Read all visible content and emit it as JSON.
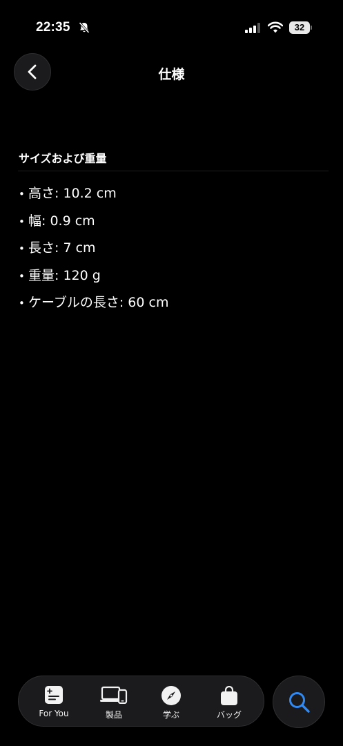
{
  "status_bar": {
    "time": "22:35",
    "battery": "32",
    "icons": [
      "bell-slash-icon",
      "cellular-signal-icon",
      "wifi-icon",
      "battery-icon"
    ]
  },
  "header": {
    "title": "仕様",
    "back_icon": "chevron-left-icon"
  },
  "section": {
    "heading": "サイズおよび重量",
    "items": [
      {
        "bullet": "•",
        "text": "高さ: 10.2 cm"
      },
      {
        "bullet": "•",
        "text": "幅: 0.9 cm"
      },
      {
        "bullet": "•",
        "text": "長さ: 7 cm"
      },
      {
        "bullet": "•",
        "text": "重量: 120 g"
      },
      {
        "bullet": "•",
        "text": "ケーブルの長さ: 60 cm"
      }
    ]
  },
  "tab_bar": {
    "tabs": [
      {
        "label": "For You",
        "icon": "for-you-icon"
      },
      {
        "label": "製品",
        "icon": "devices-icon"
      },
      {
        "label": "学ぶ",
        "icon": "compass-icon"
      },
      {
        "label": "バッグ",
        "icon": "bag-icon"
      }
    ],
    "search_icon": "search-icon"
  },
  "colors": {
    "background": "#000000",
    "surface": "#1b1b1d",
    "accent": "#2f8af5",
    "text": "#ffffff"
  }
}
